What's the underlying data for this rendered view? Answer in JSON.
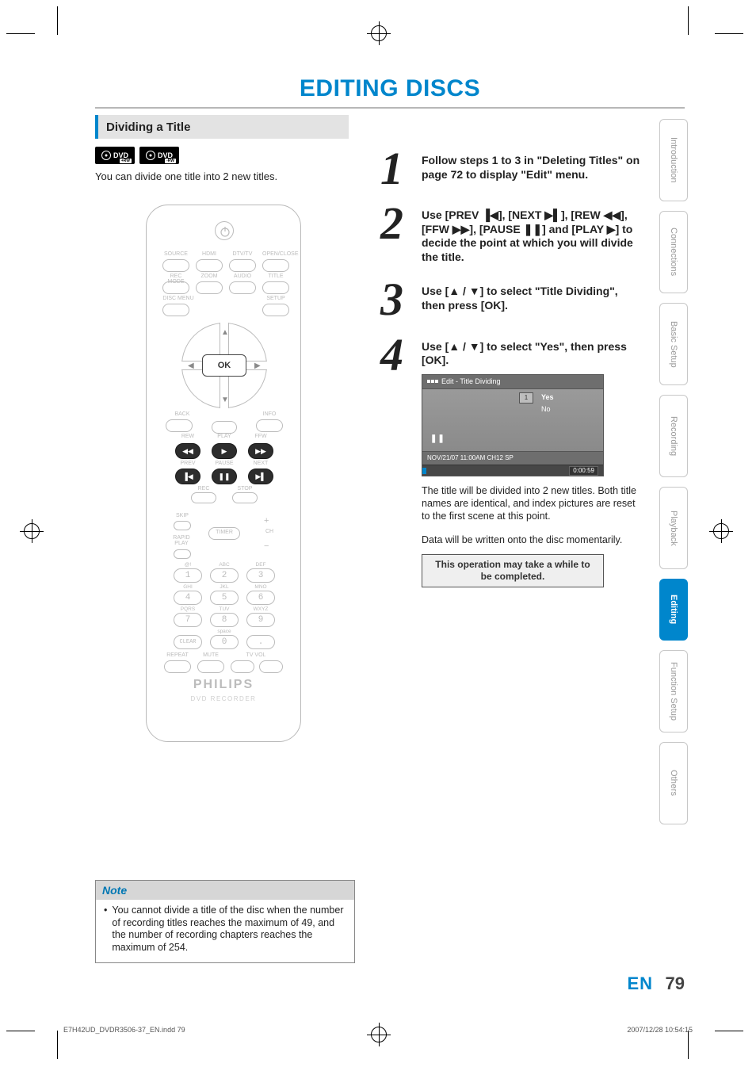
{
  "page_title": "EDITING DISCS",
  "section_title": "Dividing a Title",
  "badges": [
    "DVD",
    "DVD"
  ],
  "badges_sub": [
    "+RW",
    "-RW"
  ],
  "intro": "You can divide one title into 2 new titles.",
  "remote": {
    "ok": "OK",
    "row1_labels": [
      "SOURCE",
      "HDMI",
      "DTV/TV",
      "OPEN/CLOSE"
    ],
    "row2_labels": [
      "REC MODE",
      "ZOOM",
      "AUDIO",
      "TITLE"
    ],
    "row3_labels": [
      "DISC MENU",
      "",
      "",
      "SETUP"
    ],
    "back": "BACK",
    "info": "INFO",
    "play": "PLAY",
    "rew": "REW",
    "ffw": "FFW",
    "prev": "PREV",
    "pause": "PAUSE",
    "next": "NEXT",
    "rec": "REC",
    "stop": "STOP",
    "skip": "SKIP",
    "timer": "TIMER",
    "rapid": "RAPID\nPLAY",
    "ch": "CH",
    "kp_labels": [
      "@!",
      "ABC",
      "DEF",
      "GHI",
      "JKL",
      "MNO",
      "PQRS",
      "TUV",
      "WXYZ",
      "",
      "space",
      ""
    ],
    "kp_digits": [
      "1",
      "2",
      "3",
      "4",
      "5",
      "6",
      "7",
      "8",
      "9",
      "0"
    ],
    "clear": "CLEAR",
    "dot": ".",
    "repeat": "REPEAT",
    "mute": "MUTE",
    "tvvol": "TV VOL",
    "brand": "PHILIPS",
    "brand_sub": "DVD RECORDER"
  },
  "steps": {
    "s1": "Follow steps 1 to 3 in \"Deleting Titles\" on page 72 to display \"Edit\" menu.",
    "s2_a": "Use [PREV ",
    "s2_b": "], [NEXT ",
    "s2_c": "], [REW ",
    "s2_d": "], [FFW ",
    "s2_e": "], [PAUSE ",
    "s2_f": "] and [PLAY ",
    "s2_g": "] to decide the point at which you will divide the title.",
    "s3_a": "Use [",
    "s3_b": " / ",
    "s3_c": "] to select \"Title Dividing\", then press [OK].",
    "s4_a": "Use [",
    "s4_b": " / ",
    "s4_c": "] to select \"Yes\", then press [OK]."
  },
  "dialog": {
    "title": "Edit - Title Dividing",
    "slot": "1",
    "yes": "Yes",
    "no": "No",
    "pause": "❚❚",
    "info": "NOV/21/07 11:00AM CH12 SP",
    "time": "0:00:59"
  },
  "post_dialog": {
    "p1": "The title will be divided into 2 new titles. Both title names are identical, and index pictures are reset to the first scene at this point.",
    "p2": "Data will be written onto the disc momentarily.",
    "warn": "This operation may take a while to be completed."
  },
  "tabs": [
    "Introduction",
    "Connections",
    "Basic Setup",
    "Recording",
    "Playback",
    "Editing",
    "Function Setup",
    "Others"
  ],
  "active_tab": "Editing",
  "note": {
    "title": "Note",
    "body": "You cannot divide a title of the disc when the number of recording titles reaches the maximum of 49, and the number of recording chapters reaches the maximum of 254."
  },
  "footer": {
    "lang": "EN",
    "page": "79",
    "file": "E7H42UD_DVDR3506-37_EN.indd   79",
    "date": "2007/12/28   10:54:15"
  }
}
